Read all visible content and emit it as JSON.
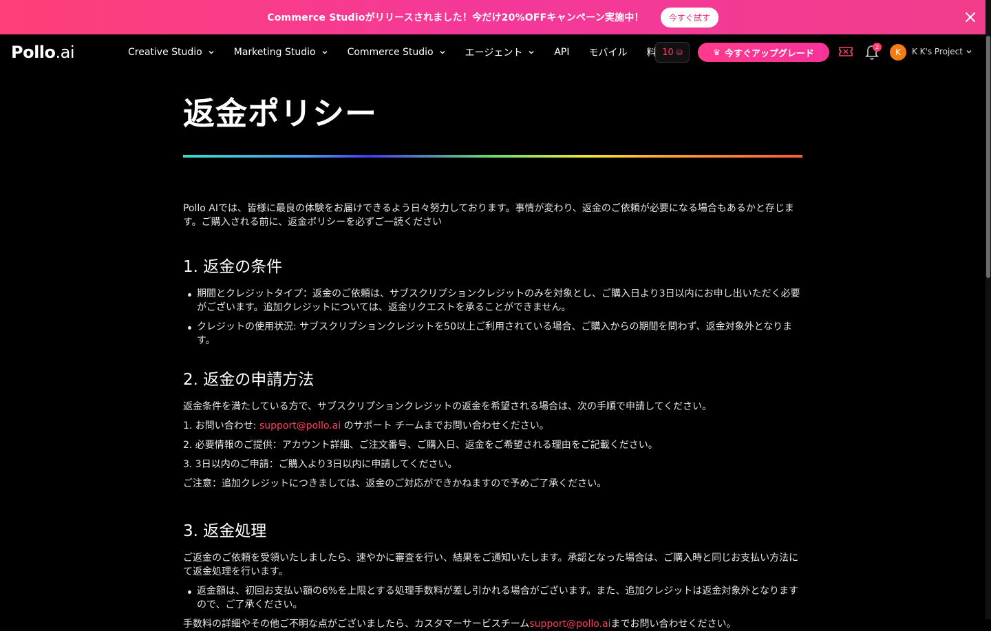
{
  "banner": {
    "text": "Commerce Studioがリリースされました！今だけ20%OFFキャンペーン実施中！",
    "button": "今すぐ試す"
  },
  "nav": {
    "logo_main": "Pollo",
    "logo_suffix": ".ai",
    "items": [
      {
        "label": "Creative Studio",
        "dropdown": true
      },
      {
        "label": "Marketing Studio",
        "dropdown": true
      },
      {
        "label": "Commerce Studio",
        "dropdown": true
      },
      {
        "label": "エージェント",
        "dropdown": true
      },
      {
        "label": "API",
        "dropdown": false
      },
      {
        "label": "モバイル",
        "dropdown": false
      },
      {
        "label": "料金",
        "dropdown": false
      }
    ],
    "credits": "10",
    "upgrade": "今すぐアップグレード",
    "notifications_count": "2",
    "avatar_initial": "K",
    "project_name": "K K's Project"
  },
  "page": {
    "title": "返金ポリシー",
    "intro": "Pollo AIでは、皆様に最良の体験をお届けできるよう日々努力しております。事情が変わり、返金のご依頼が必要になる場合もあるかと存じます。ご購入される前に、返金ポリシーを必ずご一読ください",
    "section1": {
      "heading": "1. 返金の条件",
      "items": [
        "期間とクレジットタイプ：返金のご依頼は、サブスクリプションクレジットのみを対象とし、ご購入日より3日以内にお申し出いただく必要がございます。追加クレジットについては、返金リクエストを承ることができません。",
        "クレジットの使用状況: サブスクリプションクレジットを50以上ご利用されている場合、ご購入からの期間を問わず、返金対象外となります。"
      ]
    },
    "section2": {
      "heading": "2. 返金の申請方法",
      "lead": "返金条件を満たしている方で、サブスクリプションクレジットの返金を希望される場合は、次の手順で申請してください。",
      "step1_prefix": "1. お問い合わせ: ",
      "step1_link": "support@pollo.ai",
      "step1_suffix": " のサポート チームまでお問い合わせください。",
      "step2": "2. 必要情報のご提供：アカウント詳細、ご注文番号、ご購入日、返金をご希望される理由をご記載ください。",
      "step3": "3. 3日以内のご申請：ご購入より3日以内に申請してください。",
      "note": "ご注意：追加クレジットにつきましては、返金のご対応ができかねますので予めご了承ください。"
    },
    "section3": {
      "heading": "3. 返金処理",
      "para": "ご返金のご依頼を受領いたしましたら、速やかに審査を行い、結果をご通知いたします。承認となった場合は、ご購入時と同じお支払い方法にて返金処理を行います。",
      "items": [
        "返金額は、初回お支払い額の6%を上限とする処理手数料が差し引かれる場合がございます。また、追加クレジットは返金対象外となりますので、ご了承ください。"
      ],
      "footer_prefix": "手数料の詳細やその他ご不明な点がございましたら、カスタマーサービスチーム",
      "footer_link": "support@pollo.ai",
      "footer_suffix": "までお問い合わせください。"
    }
  }
}
